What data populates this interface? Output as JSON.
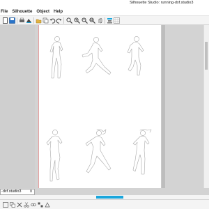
{
  "window": {
    "title": "Silhouette Studio: running-dxf.studio3"
  },
  "menu": {
    "file": "File",
    "silhouette": "Silhouette",
    "object": "Object",
    "help": "Help"
  },
  "document_tab": {
    "label": "-dxf.studio3",
    "close": "x"
  },
  "colors": {
    "accent": "#1aa6dc",
    "page_margin_line": "#e7a0a0",
    "workspace": "#d3d3d3"
  },
  "toolbar_icons": [
    "new-document-icon",
    "save-icon",
    "print-icon",
    "send-to-cutter-icon",
    "open-icon",
    "undo-icon",
    "redo-icon",
    "zoom-icon",
    "zoom-in-icon",
    "zoom-out-icon",
    "zoom-fit-icon",
    "pan-icon",
    "align-icon",
    "grid-icon"
  ],
  "canvas": {
    "figures": [
      {
        "name": "runner-silhouette-1"
      },
      {
        "name": "runner-silhouette-2"
      },
      {
        "name": "runner-silhouette-3"
      },
      {
        "name": "runner-silhouette-4"
      },
      {
        "name": "runner-silhouette-5"
      },
      {
        "name": "runner-silhouette-6"
      }
    ]
  }
}
